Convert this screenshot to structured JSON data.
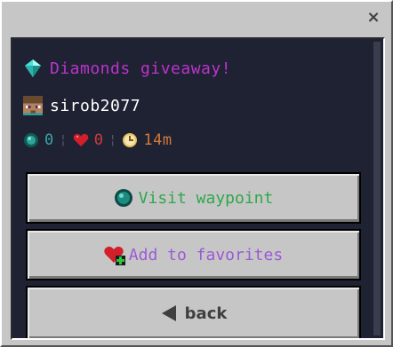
{
  "close_label": "×",
  "waypoint": {
    "title": "Diamonds giveaway!",
    "title_icon": "diamond-icon",
    "author": "sirob2077",
    "author_icon": "player-head-icon",
    "stats": {
      "visits": "0",
      "visits_icon": "ender-pearl-icon",
      "favorites": "0",
      "favorites_icon": "heart-icon",
      "age": "14m",
      "age_icon": "clock-icon",
      "separator": "¦"
    }
  },
  "buttons": {
    "visit": {
      "label": "Visit waypoint",
      "icon": "ender-pearl-icon"
    },
    "favorite": {
      "label": "Add to favorites",
      "icon": "heart-plus-icon"
    },
    "back": {
      "label": "back",
      "icon": "back-arrow-icon"
    }
  },
  "colors": {
    "title": "#bb33cc",
    "visit_label": "#2ea84a",
    "favorite_label": "#9a5bd6",
    "panel_bg": "#1f2233"
  }
}
